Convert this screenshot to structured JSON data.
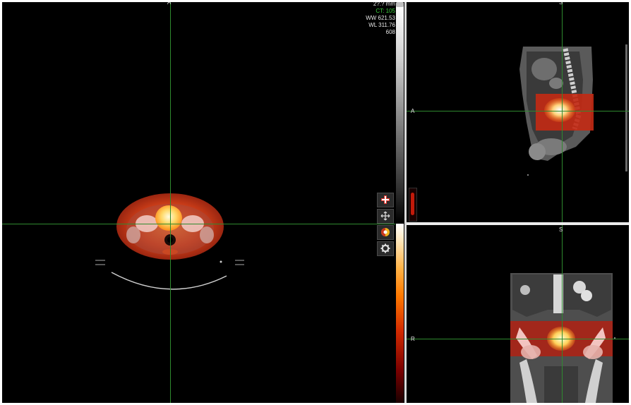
{
  "axial": {
    "orientation_top": "A"
  },
  "sagittal": {
    "orientation_top": "S",
    "orientation_left": "A"
  },
  "coronal": {
    "orientation_top": "S",
    "orientation_left": "R"
  },
  "overlay": {
    "slice_thickness": "2?.? mm",
    "ct_value": "CT: 105",
    "window_width": "WW 621.53",
    "window_level": "WL 311.76",
    "slice_number": "608"
  },
  "colormaps": {
    "ct": "grayscale",
    "pet": "hot"
  },
  "toolbar": {
    "tools": [
      {
        "name": "add-marker",
        "icon": "plus-icon"
      },
      {
        "name": "pan",
        "icon": "move-arrows-icon"
      },
      {
        "name": "fusion-blend",
        "icon": "contrast-circle-icon"
      },
      {
        "name": "settings",
        "icon": "gear-icon"
      }
    ]
  },
  "colors": {
    "crosshair": "#2f8a2f",
    "ct_label": "#3fd13f",
    "overlay_text": "#e6e6e6",
    "background": "#000000"
  }
}
